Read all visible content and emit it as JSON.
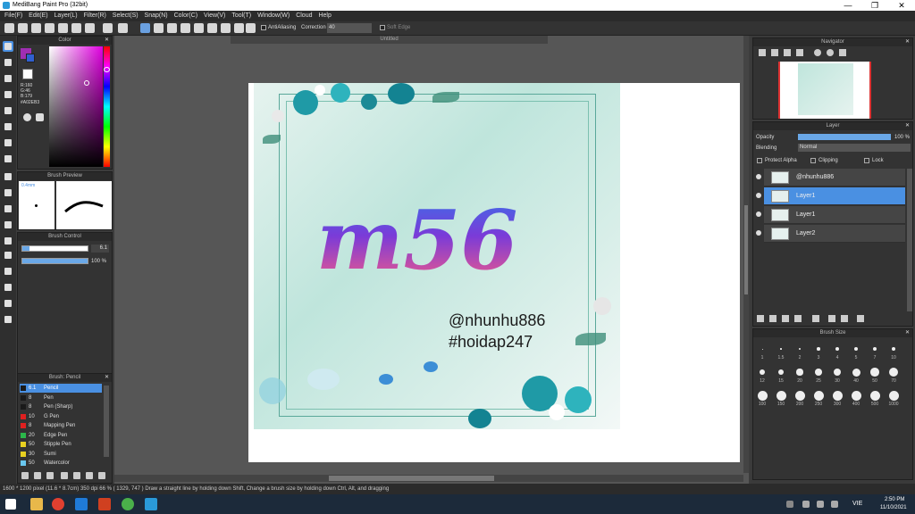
{
  "window": {
    "title": "MediBang Paint Pro (32bit)",
    "min": "—",
    "max": "❐",
    "close": "✕"
  },
  "menu": [
    "File(F)",
    "Edit(E)",
    "Layer(L)",
    "Filter(R)",
    "Select(S)",
    "Snap(N)",
    "Color(C)",
    "View(V)",
    "Tool(T)",
    "Window(W)",
    "Cloud",
    "Help"
  ],
  "toolbar": {
    "antialias_label": "AntiAliasing",
    "correction_label": "Correction",
    "correction_value": "40",
    "soft_edge_label": "Soft Edge"
  },
  "color_panel": {
    "title": "Color",
    "r": "R:160",
    "g": "G:46",
    "b": "B:179",
    "hex": "#A02EB3",
    "accent": "#A02EB3"
  },
  "brush_preview": {
    "title": "Brush Preview",
    "value": "0.4mm"
  },
  "brush_control": {
    "title": "Brush Control",
    "size_value": "6.1",
    "opacity_value": "100 %"
  },
  "brush_list": {
    "title": "Brush: Pencil",
    "items": [
      {
        "size": "6.1",
        "name": "Pencil",
        "color": "#1a1a1a"
      },
      {
        "size": "8",
        "name": "Pen",
        "color": "#1a1a1a"
      },
      {
        "size": "8",
        "name": "Pen (Sharp)",
        "color": "#1a1a1a"
      },
      {
        "size": "10",
        "name": "G Pen",
        "color": "#e02020"
      },
      {
        "size": "8",
        "name": "Mapping Pen",
        "color": "#e02020"
      },
      {
        "size": "20",
        "name": "Edge Pen",
        "color": "#2bb84a"
      },
      {
        "size": "50",
        "name": "Stipple Pen",
        "color": "#e8d020"
      },
      {
        "size": "30",
        "name": "Sumi",
        "color": "#e8d020"
      },
      {
        "size": "50",
        "name": "Watercolor",
        "color": "#6ac8f0"
      }
    ]
  },
  "canvas": {
    "tab": "Untitled",
    "art_text_1": "m56",
    "handle": "@nhunhu886",
    "tag": "#hoidap247"
  },
  "navigator": {
    "title": "Navigator"
  },
  "layer_panel": {
    "title": "Layer",
    "opacity_label": "Opacity",
    "opacity_value": "100 %",
    "blending_label": "Blending",
    "blending_value": "Normal",
    "protect_alpha": "Protect Alpha",
    "clipping": "Clipping",
    "lock": "Lock",
    "layers": [
      {
        "name": "@nhunhu886"
      },
      {
        "name": "Layer1"
      },
      {
        "name": "Layer1"
      },
      {
        "name": "Layer2"
      }
    ]
  },
  "brush_size": {
    "title": "Brush Size",
    "row1": [
      "1",
      "1.5",
      "2",
      "3",
      "4",
      "5",
      "7",
      "10"
    ],
    "row2": [
      "12",
      "15",
      "20",
      "25",
      "30",
      "40",
      "50",
      "70"
    ],
    "row3": [
      "100",
      "150",
      "200",
      "250",
      "300",
      "400",
      "500",
      "1000"
    ]
  },
  "status": {
    "text": "1600 * 1200 pixel  (11.6 * 8.7cm)  350 dpi  66 %  ( 1329, 747 )  Draw a straight line by holding down Shift, Change a brush size by holding down Ctrl, Alt, and dragging"
  },
  "taskbar": {
    "time": "2:50 PM",
    "date": "11/10/2021",
    "lang": "VIE"
  }
}
